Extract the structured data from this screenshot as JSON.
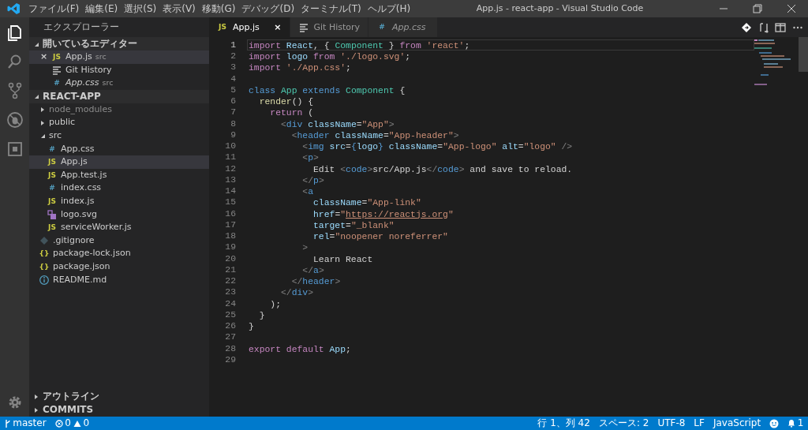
{
  "window": {
    "title": "App.js - react-app - Visual Studio Code"
  },
  "menu": [
    "ファイル(F)",
    "編集(E)",
    "選択(S)",
    "表示(V)",
    "移動(G)",
    "デバッグ(D)",
    "ターミナル(T)",
    "ヘルプ(H)"
  ],
  "activity_bar": [
    {
      "kind": "explorer",
      "selected": true
    },
    {
      "kind": "search",
      "selected": false
    },
    {
      "kind": "scm",
      "selected": false
    },
    {
      "kind": "debug",
      "selected": false
    },
    {
      "kind": "extensions",
      "selected": false
    }
  ],
  "sidebar": {
    "title": "エクスプローラー",
    "open_editors": {
      "title": "開いているエディター",
      "expanded": true,
      "items": [
        {
          "name": "App.js",
          "folder": "src",
          "glyph": "JS",
          "kind": "js",
          "close": "×",
          "preview": false,
          "selected": true
        },
        {
          "name": "Git History",
          "kind": "lines",
          "preview": false,
          "selected": false
        },
        {
          "name": "App.css",
          "folder": "src",
          "glyph": "#",
          "kind": "css",
          "preview": true,
          "selected": false
        }
      ]
    },
    "project": {
      "title": "REACT-APP",
      "expanded": true,
      "items": [
        {
          "name": "node_modules",
          "kind": "folder",
          "expanded": false,
          "ignored": true,
          "selected": false
        },
        {
          "name": "public",
          "kind": "folder",
          "expanded": false,
          "ignored": false,
          "selected": false
        },
        {
          "name": "src",
          "kind": "folder",
          "expanded": true,
          "ignored": false,
          "selected": false,
          "children": [
            {
              "name": "App.css",
              "kind": "css",
              "glyph": "#",
              "ignored": false,
              "selected": false
            },
            {
              "name": "App.js",
              "kind": "js",
              "glyph": "JS",
              "ignored": false,
              "selected": true
            },
            {
              "name": "App.test.js",
              "kind": "js",
              "glyph": "JS",
              "ignored": false,
              "selected": false
            },
            {
              "name": "index.css",
              "kind": "css",
              "glyph": "#",
              "ignored": false,
              "selected": false
            },
            {
              "name": "index.js",
              "kind": "js",
              "glyph": "JS",
              "ignored": false,
              "selected": false
            },
            {
              "name": "logo.svg",
              "kind": "svg",
              "ignored": false,
              "selected": false
            },
            {
              "name": "serviceWorker.js",
              "kind": "js",
              "glyph": "JS",
              "ignored": false,
              "selected": false
            }
          ]
        },
        {
          "name": ".gitignore",
          "kind": "git",
          "ignored": false,
          "selected": false
        },
        {
          "name": "package-lock.json",
          "kind": "json",
          "glyph": "{}",
          "ignored": false,
          "selected": false
        },
        {
          "name": "package.json",
          "kind": "json",
          "glyph": "{}",
          "ignored": false,
          "selected": false
        },
        {
          "name": "README.md",
          "kind": "info",
          "ignored": false,
          "selected": false
        }
      ]
    },
    "bottom_sections": [
      {
        "title": "アウトライン",
        "expanded": false
      },
      {
        "title": "COMMITS",
        "expanded": false
      }
    ]
  },
  "tabs": [
    {
      "label": "App.js",
      "glyph": "JS",
      "kind": "js",
      "close": "×",
      "selected": true,
      "preview": false
    },
    {
      "label": "Git History",
      "kind": "lines",
      "selected": false,
      "preview": false
    },
    {
      "label": "App.css",
      "glyph": "#",
      "kind": "css",
      "selected": false,
      "preview": true
    }
  ],
  "editor": {
    "lines": [
      {
        "number": "1",
        "current": true,
        "tokens": [
          {
            "kind": "kw",
            "text": "import"
          },
          {
            "kind": "var",
            "text": " React"
          },
          {
            "kind": "p",
            "text": ", { "
          },
          {
            "kind": "cls",
            "text": "Component"
          },
          {
            "kind": "p",
            "text": " } "
          },
          {
            "kind": "kw",
            "text": "from"
          },
          {
            "kind": "str",
            "text": " 'react'"
          },
          {
            "kind": "p",
            "text": ";"
          }
        ]
      },
      {
        "number": "2",
        "current": false,
        "tokens": [
          {
            "kind": "kw",
            "text": "import"
          },
          {
            "kind": "var",
            "text": " logo"
          },
          {
            "kind": "kw",
            "text": " from"
          },
          {
            "kind": "str",
            "text": " './logo.svg'"
          },
          {
            "kind": "p",
            "text": ";"
          }
        ]
      },
      {
        "number": "3",
        "current": false,
        "tokens": [
          {
            "kind": "kw",
            "text": "import"
          },
          {
            "kind": "str",
            "text": " './App.css'"
          },
          {
            "kind": "p",
            "text": ";"
          }
        ]
      },
      {
        "number": "4",
        "current": false
      },
      {
        "number": "5",
        "current": false,
        "tokens": [
          {
            "kind": "blue",
            "text": "class"
          },
          {
            "kind": "cls",
            "text": " App"
          },
          {
            "kind": "blue",
            "text": " extends"
          },
          {
            "kind": "cls",
            "text": " Component"
          },
          {
            "kind": "p",
            "text": " {"
          }
        ]
      },
      {
        "number": "6",
        "current": false,
        "tokens": [
          {
            "kind": "fn",
            "text": "  render"
          },
          {
            "kind": "p",
            "text": "() {"
          }
        ]
      },
      {
        "number": "7",
        "current": false,
        "tokens": [
          {
            "kind": "kw",
            "text": "    return"
          },
          {
            "kind": "p",
            "text": " ("
          }
        ]
      },
      {
        "number": "8",
        "current": false,
        "tokens": [
          {
            "kind": "punc",
            "text": "      <"
          },
          {
            "kind": "blue",
            "text": "div"
          },
          {
            "kind": "var",
            "text": " className"
          },
          {
            "kind": "p",
            "text": "="
          },
          {
            "kind": "str",
            "text": "\"App\""
          },
          {
            "kind": "punc",
            "text": ">"
          }
        ]
      },
      {
        "number": "9",
        "current": false,
        "tokens": [
          {
            "kind": "punc",
            "text": "        <"
          },
          {
            "kind": "blue",
            "text": "header"
          },
          {
            "kind": "var",
            "text": " className"
          },
          {
            "kind": "p",
            "text": "="
          },
          {
            "kind": "str",
            "text": "\"App-header\""
          },
          {
            "kind": "punc",
            "text": ">"
          }
        ]
      },
      {
        "number": "10",
        "current": false,
        "tokens": [
          {
            "kind": "punc",
            "text": "          <"
          },
          {
            "kind": "blue",
            "text": "img"
          },
          {
            "kind": "var",
            "text": " src"
          },
          {
            "kind": "p",
            "text": "="
          },
          {
            "kind": "blue",
            "text": "{"
          },
          {
            "kind": "var",
            "text": "logo"
          },
          {
            "kind": "blue",
            "text": "}"
          },
          {
            "kind": "var",
            "text": " className"
          },
          {
            "kind": "p",
            "text": "="
          },
          {
            "kind": "str",
            "text": "\"App-logo\""
          },
          {
            "kind": "var",
            "text": " alt"
          },
          {
            "kind": "p",
            "text": "="
          },
          {
            "kind": "str",
            "text": "\"logo\""
          },
          {
            "kind": "punc",
            "text": " />"
          }
        ]
      },
      {
        "number": "11",
        "current": false,
        "tokens": [
          {
            "kind": "punc",
            "text": "          <"
          },
          {
            "kind": "blue",
            "text": "p"
          },
          {
            "kind": "punc",
            "text": ">"
          }
        ]
      },
      {
        "number": "12",
        "current": false,
        "tokens": [
          {
            "kind": "p",
            "text": "            Edit "
          },
          {
            "kind": "punc",
            "text": "<"
          },
          {
            "kind": "blue",
            "text": "code"
          },
          {
            "kind": "punc",
            "text": ">"
          },
          {
            "kind": "p",
            "text": "src/App.js"
          },
          {
            "kind": "punc",
            "text": "</"
          },
          {
            "kind": "blue",
            "text": "code"
          },
          {
            "kind": "punc",
            "text": ">"
          },
          {
            "kind": "p",
            "text": " and save to reload."
          }
        ]
      },
      {
        "number": "13",
        "current": false,
        "tokens": [
          {
            "kind": "punc",
            "text": "          </"
          },
          {
            "kind": "blue",
            "text": "p"
          },
          {
            "kind": "punc",
            "text": ">"
          }
        ]
      },
      {
        "number": "14",
        "current": false,
        "tokens": [
          {
            "kind": "punc",
            "text": "          <"
          },
          {
            "kind": "blue",
            "text": "a"
          }
        ]
      },
      {
        "number": "15",
        "current": false,
        "tokens": [
          {
            "kind": "var",
            "text": "            className"
          },
          {
            "kind": "p",
            "text": "="
          },
          {
            "kind": "str",
            "text": "\"App-link\""
          }
        ]
      },
      {
        "number": "16",
        "current": false,
        "tokens": [
          {
            "kind": "var",
            "text": "            href"
          },
          {
            "kind": "p",
            "text": "="
          },
          {
            "kind": "str",
            "text": "\""
          },
          {
            "kind": "url",
            "text": "https://reactjs.org"
          },
          {
            "kind": "str",
            "text": "\""
          }
        ]
      },
      {
        "number": "17",
        "current": false,
        "tokens": [
          {
            "kind": "var",
            "text": "            target"
          },
          {
            "kind": "p",
            "text": "="
          },
          {
            "kind": "str",
            "text": "\"_blank\""
          }
        ]
      },
      {
        "number": "18",
        "current": false,
        "tokens": [
          {
            "kind": "var",
            "text": "            rel"
          },
          {
            "kind": "p",
            "text": "="
          },
          {
            "kind": "str",
            "text": "\"noopener noreferrer\""
          }
        ]
      },
      {
        "number": "19",
        "current": false,
        "tokens": [
          {
            "kind": "punc",
            "text": "          >"
          }
        ]
      },
      {
        "number": "20",
        "current": false,
        "tokens": [
          {
            "kind": "p",
            "text": "            Learn React"
          }
        ]
      },
      {
        "number": "21",
        "current": false,
        "tokens": [
          {
            "kind": "punc",
            "text": "          </"
          },
          {
            "kind": "blue",
            "text": "a"
          },
          {
            "kind": "punc",
            "text": ">"
          }
        ]
      },
      {
        "number": "22",
        "current": false,
        "tokens": [
          {
            "kind": "punc",
            "text": "        </"
          },
          {
            "kind": "blue",
            "text": "header"
          },
          {
            "kind": "punc",
            "text": ">"
          }
        ]
      },
      {
        "number": "23",
        "current": false,
        "tokens": [
          {
            "kind": "punc",
            "text": "      </"
          },
          {
            "kind": "blue",
            "text": "div"
          },
          {
            "kind": "punc",
            "text": ">"
          }
        ]
      },
      {
        "number": "24",
        "current": false,
        "tokens": [
          {
            "kind": "p",
            "text": "    );"
          }
        ]
      },
      {
        "number": "25",
        "current": false,
        "tokens": [
          {
            "kind": "p",
            "text": "  }"
          }
        ]
      },
      {
        "number": "26",
        "current": false,
        "tokens": [
          {
            "kind": "p",
            "text": "}"
          }
        ]
      },
      {
        "number": "27",
        "current": false
      },
      {
        "number": "28",
        "current": false,
        "tokens": [
          {
            "kind": "kw",
            "text": "export"
          },
          {
            "kind": "kw",
            "text": " default"
          },
          {
            "kind": "var",
            "text": " App"
          },
          {
            "kind": "p",
            "text": ";"
          }
        ]
      },
      {
        "number": "29",
        "current": false
      }
    ]
  },
  "status_bar": {
    "branch": "master",
    "errors": "0",
    "warnings": "0",
    "position": "行 1、列 42",
    "indent": "スペース: 2",
    "encoding": "UTF-8",
    "eol": "LF",
    "language": "JavaScript",
    "notifications": "1"
  }
}
